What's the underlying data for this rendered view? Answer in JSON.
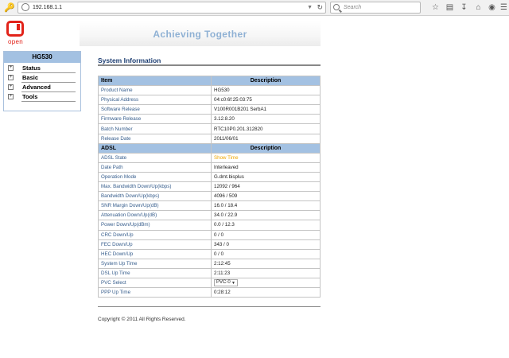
{
  "browser": {
    "url": "192.168.1.1",
    "search_placeholder": "Search",
    "icons": [
      "key-icon",
      "globe-icon",
      "reload-icon",
      "search-icon",
      "star-icon",
      "clipboard-icon",
      "download-icon",
      "home-icon",
      "chat-icon",
      "menu-icon"
    ]
  },
  "header": {
    "logo_text": "open",
    "slogan": "Achieving Together"
  },
  "menu": {
    "title": "HG530",
    "items": [
      {
        "label": "Status"
      },
      {
        "label": "Basic"
      },
      {
        "label": "Advanced"
      },
      {
        "label": "Tools"
      }
    ]
  },
  "main": {
    "title": "System Information",
    "table_head_item": "Item",
    "table_head_desc": "Description",
    "rows": [
      {
        "label": "Product Name",
        "value": "HG530"
      },
      {
        "label": "Physical Address",
        "value": "04:c0:6f:25:03:75"
      },
      {
        "label": "Software Release",
        "value": "V100R001B201 SerbA1"
      },
      {
        "label": "Firmware Release",
        "value": "3.12.8.20"
      },
      {
        "label": "Batch Number",
        "value": "RTC10P0.201.312820"
      },
      {
        "label": "Release Date",
        "value": "2011/06/01"
      }
    ],
    "adsl_head": "ADSL",
    "adsl_head_desc": "Description",
    "adsl_rows": [
      {
        "label": "ADSL State",
        "value": "Show Time"
      },
      {
        "label": "Date Path",
        "value": "Interleaved"
      },
      {
        "label": "Operation Mode",
        "value": "G.dmt.bisplus"
      },
      {
        "label": "Max. Bandwidth Down/Up(kbps)",
        "value": "12092 / 964"
      },
      {
        "label": "Bandwidth Down/Up(kbps)",
        "value": "4096 / 509"
      },
      {
        "label": "SNR Margin Down/Up(dB)",
        "value": "16.0 / 18.4"
      },
      {
        "label": "Attenuation Down/Up(dB)",
        "value": "34.0 / 22.9"
      },
      {
        "label": "Power Down/Up(dBm)",
        "value": "0.0 / 12.3"
      },
      {
        "label": "CRC Down/Up",
        "value": "0 / 0"
      },
      {
        "label": "FEC  Down/Up",
        "value": "343 / 0"
      },
      {
        "label": "HEC Down/Up",
        "value": "0 / 0"
      },
      {
        "label": "System Up Time",
        "value": "2:12:45"
      },
      {
        "label": "DSL Up Time",
        "value": "2:11:23"
      },
      {
        "label": "PVC Select",
        "value": "PVC-0"
      },
      {
        "label": "PPP Up Time",
        "value": "0:28:12"
      }
    ],
    "status_color": "#f1a700"
  },
  "footer": {
    "copyright": "Copyright © 2011 All Rights Reserved."
  }
}
